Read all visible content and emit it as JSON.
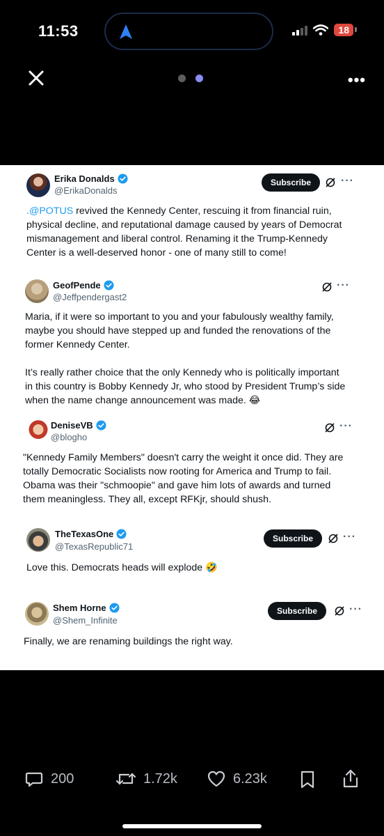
{
  "status_bar": {
    "time": "11:53",
    "battery": "18",
    "battery_color": "#e0483e",
    "accent_color": "#2f81f7"
  },
  "top_nav": {
    "close_icon": "close-icon",
    "more_icon": "more-icon",
    "page_dots": 2,
    "active_dot": 2
  },
  "replies": [
    {
      "name": "Erika Donalds",
      "handle": "@ErikaDonalds",
      "subscribe": "Subscribe",
      "mention": ".@POTUS",
      "text_lines": [
        " revived the Kennedy Center, rescuing it from financial ruin,",
        "physical decline, and reputational damage caused by years of Democrat",
        "mismanagement and liberal control.  Renaming it the Trump-Kennedy",
        "Center is a well-deserved honor - one of many still to come!"
      ]
    },
    {
      "name": "GeofPende",
      "handle": "@Jeffpendergast2",
      "text_lines": [
        "Maria, if it were so important to you and your fabulously wealthy family,",
        "maybe you should have stepped up and funded the renovations of the",
        "former Kennedy Center.",
        "",
        "It’s really rather choice that the only Kennedy who is politically important",
        "in this country is Bobby Kennedy Jr, who stood by President Trump’s side",
        "when the name change announcement was made. 😂"
      ]
    },
    {
      "name": "DeniseVB",
      "handle": "@blogho",
      "text_lines": [
        "\"Kennedy Family Members\" doesn't carry the weight it once did. They are",
        "totally Democratic Socialists now rooting for America and Trump to fail.",
        "Obama was their \"schmoopie\" and gave him lots of awards and turned",
        "them meaningless.  They all, except RFKjr, should shush."
      ]
    },
    {
      "name": "TheTexasOne",
      "handle": "@TexasRepublic71",
      "subscribe": "Subscribe",
      "text_lines": [
        "Love this. Democrats heads will explode 🤣"
      ]
    },
    {
      "name": "Shem Horne",
      "handle": "@Shem_Infinite",
      "subscribe": "Subscribe",
      "text_lines": [
        "Finally, we are renaming buildings the right way."
      ]
    }
  ],
  "action_bar": {
    "replies": "200",
    "reposts": "1.72k",
    "likes": "6.23k"
  },
  "colors": {
    "verified": "#1d9bf0",
    "link": "#1d9bf0",
    "subscribe_bg": "#0f1419"
  }
}
